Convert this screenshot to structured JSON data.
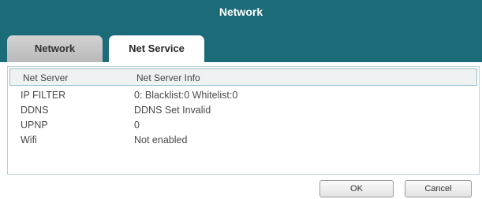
{
  "window": {
    "title": "Network"
  },
  "tabs": [
    {
      "label": "Network",
      "active": false
    },
    {
      "label": "Net Service",
      "active": true
    }
  ],
  "table": {
    "columns": [
      "Net Server",
      "Net Server Info"
    ],
    "rows": [
      {
        "server": "IP FILTER",
        "info": "0: Blacklist:0 Whitelist:0"
      },
      {
        "server": "DDNS",
        "info": "DDNS Set Invalid"
      },
      {
        "server": "UPNP",
        "info": "0"
      },
      {
        "server": "Wifi",
        "info": "Not enabled"
      }
    ]
  },
  "buttons": {
    "ok_label": "OK",
    "cancel_label": "Cancel"
  },
  "colors": {
    "titlebar": "#1b6b79",
    "header_border": "#8fc0c8"
  }
}
